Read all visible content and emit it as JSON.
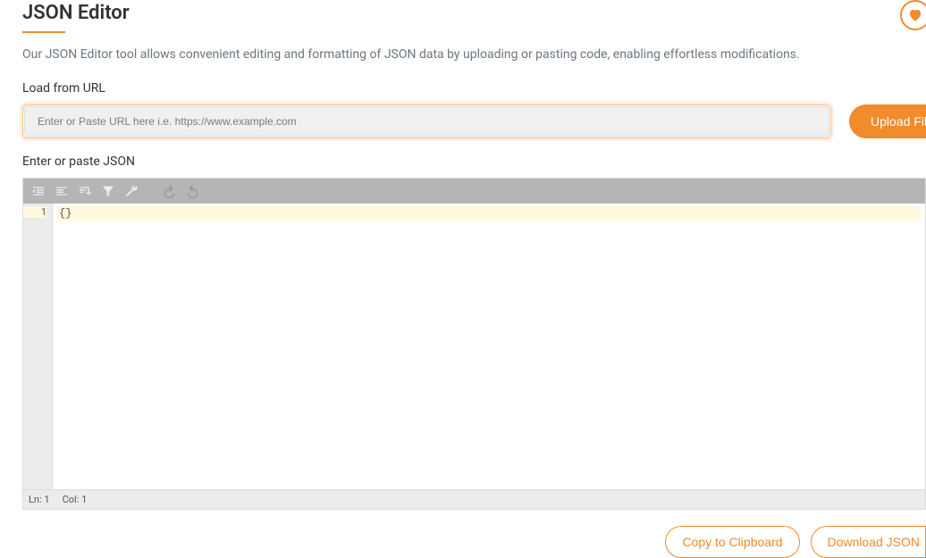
{
  "header": {
    "title": "JSON Editor",
    "description": "Our JSON Editor tool allows convenient editing and formatting of JSON data by uploading or pasting code, enabling effortless modifications."
  },
  "urlSection": {
    "label": "Load from URL",
    "placeholder": "Enter or Paste URL here i.e. https://www.example.com",
    "value": ""
  },
  "uploadButton": {
    "label": "Upload File"
  },
  "editorSection": {
    "label": "Enter or paste JSON",
    "lineNumber": "1",
    "content": "{}",
    "status": {
      "line": "Ln: 1",
      "col": "Col: 1"
    }
  },
  "actions": {
    "copy": "Copy to Clipboard",
    "download": "Download JSON"
  }
}
